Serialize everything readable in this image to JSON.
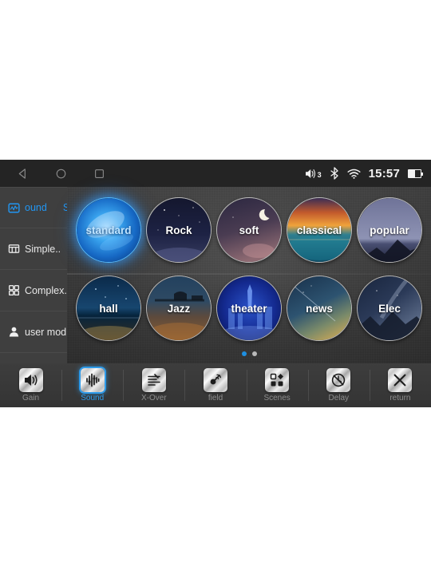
{
  "statusbar": {
    "nav": [
      {
        "name": "back",
        "icon": "triangle-left-icon"
      },
      {
        "name": "home",
        "icon": "circle-icon"
      },
      {
        "name": "recents",
        "icon": "square-icon"
      }
    ],
    "volume_icon": "speaker-icon",
    "volume_level": "3",
    "bluetooth_icon": "bluetooth-icon",
    "wifi_icon": "wifi-icon",
    "time": "15:57",
    "battery_icon": "battery-icon"
  },
  "sidebar": {
    "items": [
      {
        "label": "Sound",
        "label_visible": "ound",
        "extra": "S",
        "icon": "waveform-icon",
        "active": true
      },
      {
        "label": "Simple..",
        "icon": "layout-columns-icon",
        "active": false
      },
      {
        "label": "Complex...",
        "icon": "grid-four-icon",
        "active": false
      },
      {
        "label": "user mod..",
        "icon": "user-icon",
        "active": false
      }
    ]
  },
  "presets": {
    "rows": [
      [
        {
          "label": "standard",
          "selected": true,
          "theme": "aurora-blue"
        },
        {
          "label": "Rock",
          "selected": false,
          "theme": "night-sky"
        },
        {
          "label": "soft",
          "selected": false,
          "theme": "moon-dusk"
        },
        {
          "label": "classical",
          "selected": false,
          "theme": "sunset-sea"
        },
        {
          "label": "popular",
          "selected": false,
          "theme": "mountain-haze"
        }
      ],
      [
        {
          "label": "hall",
          "selected": false,
          "theme": "starry-lake"
        },
        {
          "label": "Jazz",
          "selected": false,
          "theme": "bridge-dawn"
        },
        {
          "label": "theater",
          "selected": false,
          "theme": "city-blue"
        },
        {
          "label": "news",
          "selected": false,
          "theme": "golden-dust"
        },
        {
          "label": "Elec",
          "selected": false,
          "theme": "milkyway-peak"
        }
      ]
    ],
    "pager": {
      "count": 2,
      "current": 1
    }
  },
  "toolbar": {
    "items": [
      {
        "label": "Gain",
        "icon": "speaker-gain-icon",
        "active": false
      },
      {
        "label": "Sound",
        "icon": "equalizer-icon",
        "active": true
      },
      {
        "label": "X-Over",
        "icon": "crossover-icon",
        "active": false
      },
      {
        "label": "field",
        "icon": "sound-field-icon",
        "active": false
      },
      {
        "label": "Scenes",
        "icon": "scenes-grid-icon",
        "active": false
      },
      {
        "label": "Delay",
        "icon": "delay-clock-icon",
        "active": false
      },
      {
        "label": "return",
        "icon": "close-x-icon",
        "active": false
      }
    ]
  },
  "colors": {
    "accent": "#2e9bea",
    "screen_bg": "#3a3a3a",
    "statusbar_bg": "#242424",
    "sidebar_bg": "#3f3f3f"
  }
}
